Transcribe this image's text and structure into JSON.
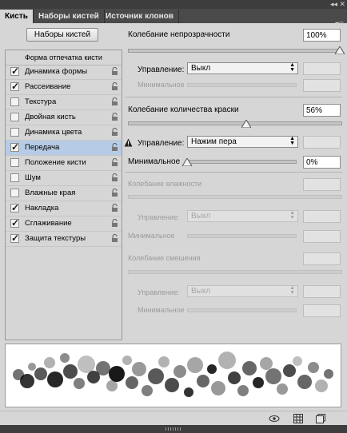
{
  "window": {
    "collapse_icon": "double-chevron",
    "close_icon": "close"
  },
  "tabs": [
    {
      "label": "Кисть",
      "active": true
    },
    {
      "label": "Наборы кистей",
      "active": false
    },
    {
      "label": "Источник клонов",
      "active": false
    }
  ],
  "brush_presets_button": "Наборы кистей",
  "list": {
    "header": "Форма отпечатка кисти",
    "items": [
      {
        "label": "Динамика формы",
        "checked": true,
        "selected": false
      },
      {
        "label": "Рассеивание",
        "checked": true,
        "selected": false
      },
      {
        "label": "Текстура",
        "checked": false,
        "selected": false
      },
      {
        "label": "Двойная кисть",
        "checked": false,
        "selected": false
      },
      {
        "label": "Динамика цвета",
        "checked": false,
        "selected": false
      },
      {
        "label": "Передача",
        "checked": true,
        "selected": true
      },
      {
        "label": "Положение кисти",
        "checked": false,
        "selected": false
      },
      {
        "label": "Шум",
        "checked": false,
        "selected": false
      },
      {
        "label": "Влажные края",
        "checked": false,
        "selected": false
      },
      {
        "label": "Накладка",
        "checked": true,
        "selected": false
      },
      {
        "label": "Сглаживание",
        "checked": true,
        "selected": false
      },
      {
        "label": "Защита текстуры",
        "checked": true,
        "selected": false
      }
    ]
  },
  "right": {
    "opacity_jitter": {
      "label": "Колебание непрозрачности",
      "value": "100%",
      "level": 1.0
    },
    "opacity_control": {
      "label": "Управление:",
      "selected": "Выкл"
    },
    "opacity_min": {
      "label": "Минимальное"
    },
    "flow_jitter": {
      "label": "Колебание количества краски",
      "value": "56%",
      "level": 0.56
    },
    "flow_control": {
      "label": "Управление:",
      "selected": "Нажим пера"
    },
    "flow_min": {
      "label": "Минимальное",
      "value": "0%",
      "level": 0.0
    },
    "wetness_jitter": {
      "label": "Колебание влажности"
    },
    "wetness_control": {
      "label": "Управление:",
      "selected": "Выкл"
    },
    "wetness_min": {
      "label": "Минимальное"
    },
    "mix_jitter": {
      "label": "Колебание смешения"
    },
    "mix_control": {
      "label": "Управление:",
      "selected": "Выкл"
    },
    "mix_min": {
      "label": "Минимальное"
    }
  },
  "bottom_icons": [
    "eye-icon",
    "grid-icon",
    "new-preset-icon"
  ]
}
